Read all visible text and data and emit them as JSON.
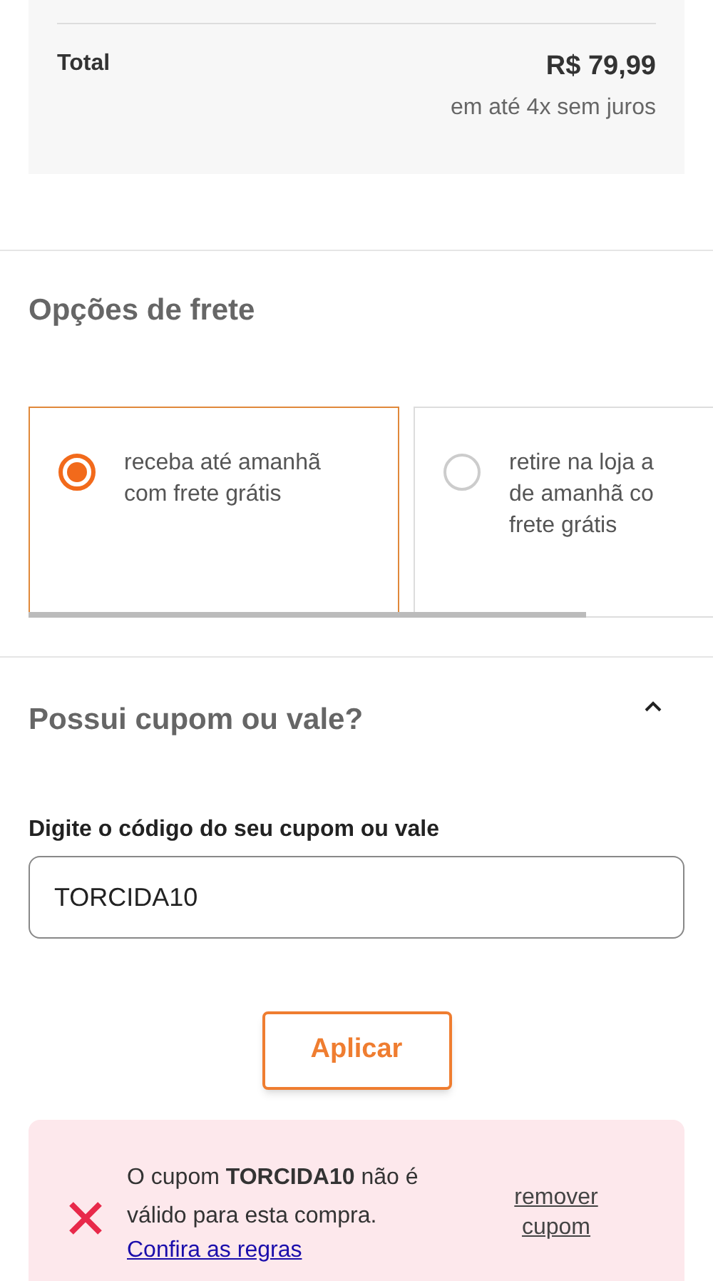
{
  "summary": {
    "total_label": "Total",
    "total_value": "R$ 79,99",
    "installments": "em até 4x sem juros"
  },
  "shipping": {
    "title": "Opções de frete",
    "options": [
      {
        "lines": [
          "receba até amanhã",
          "com frete grátis"
        ],
        "selected": true
      },
      {
        "lines": [
          "retire na loja a",
          "de amanhã co",
          "frete grátis"
        ],
        "selected": false
      }
    ]
  },
  "coupon": {
    "title": "Possui cupom ou vale?",
    "expanded": true,
    "field_label": "Digite o código do seu cupom ou vale",
    "value": "TORCIDA10",
    "apply_button": "Aplicar",
    "error": {
      "message": "O cupom **TORCIDA10** não é válido para esta compra.",
      "rules_link": "Confira as regras",
      "remove_link": "remover cupom"
    }
  }
}
